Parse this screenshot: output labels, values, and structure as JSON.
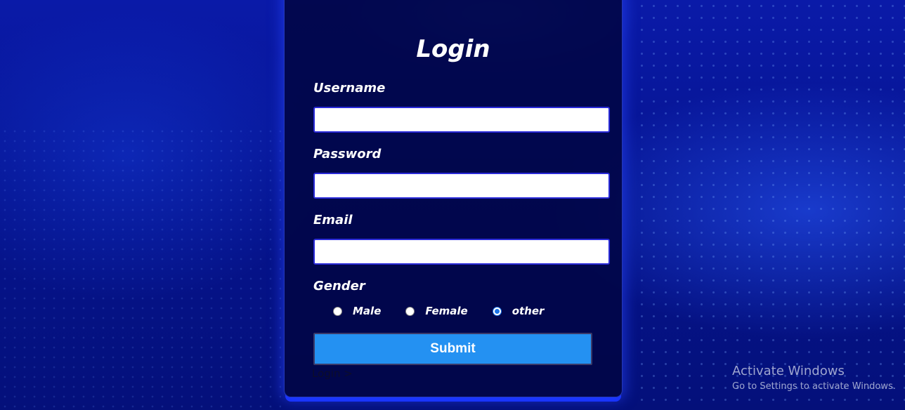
{
  "form": {
    "title": "Login",
    "username_label": "Username",
    "username_value": "",
    "password_label": "Password",
    "password_value": "",
    "email_label": "Email",
    "email_value": "",
    "gender_label": "Gender",
    "gender_options": [
      {
        "label": "Male",
        "checked": false
      },
      {
        "label": "Female",
        "checked": false
      },
      {
        "label": "other",
        "checked": true
      }
    ],
    "submit_label": "Submit",
    "login_link": "Login >"
  },
  "watermark": {
    "title": "Activate Windows",
    "subtitle": "Go to Settings to activate Windows."
  },
  "colors": {
    "submit_button": "#2491f2",
    "background": "#061490",
    "panel": "#010646",
    "radio_checked": "#1a73e8"
  },
  "icons": {
    "radio_checked": "radio-selected-icon",
    "radio_unchecked": "radio-unselected-icon"
  }
}
